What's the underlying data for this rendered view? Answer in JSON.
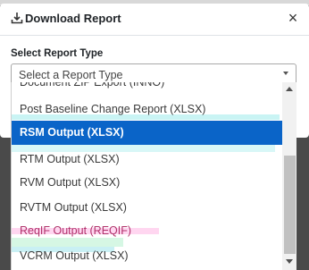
{
  "dialog": {
    "title": "Download Report",
    "close_label": "×",
    "field_label": "Select Report Type",
    "select": {
      "placeholder": "Select a Report Type"
    }
  },
  "dropdown": {
    "items": [
      {
        "label": "Document ZIP Export (INNO)"
      },
      {
        "label": "Post Baseline Change Report (XLSX)"
      },
      {
        "label": "RSM Output (XLSX)",
        "selected": true
      },
      {
        "label": "RTM Output (XLSX)"
      },
      {
        "label": "RVM Output (XLSX)"
      },
      {
        "label": "RVTM Output (XLSX)"
      },
      {
        "label": "ReqIF Output (REQIF)"
      },
      {
        "label": "VCRM Output (XLSX)"
      }
    ]
  },
  "colors": {
    "selected_bg": "#0a64c8",
    "overlay": "#4a4a4a"
  },
  "icons": {
    "title_icon": "download-icon",
    "close": "close-icon",
    "caret": "chevron-down-icon"
  }
}
